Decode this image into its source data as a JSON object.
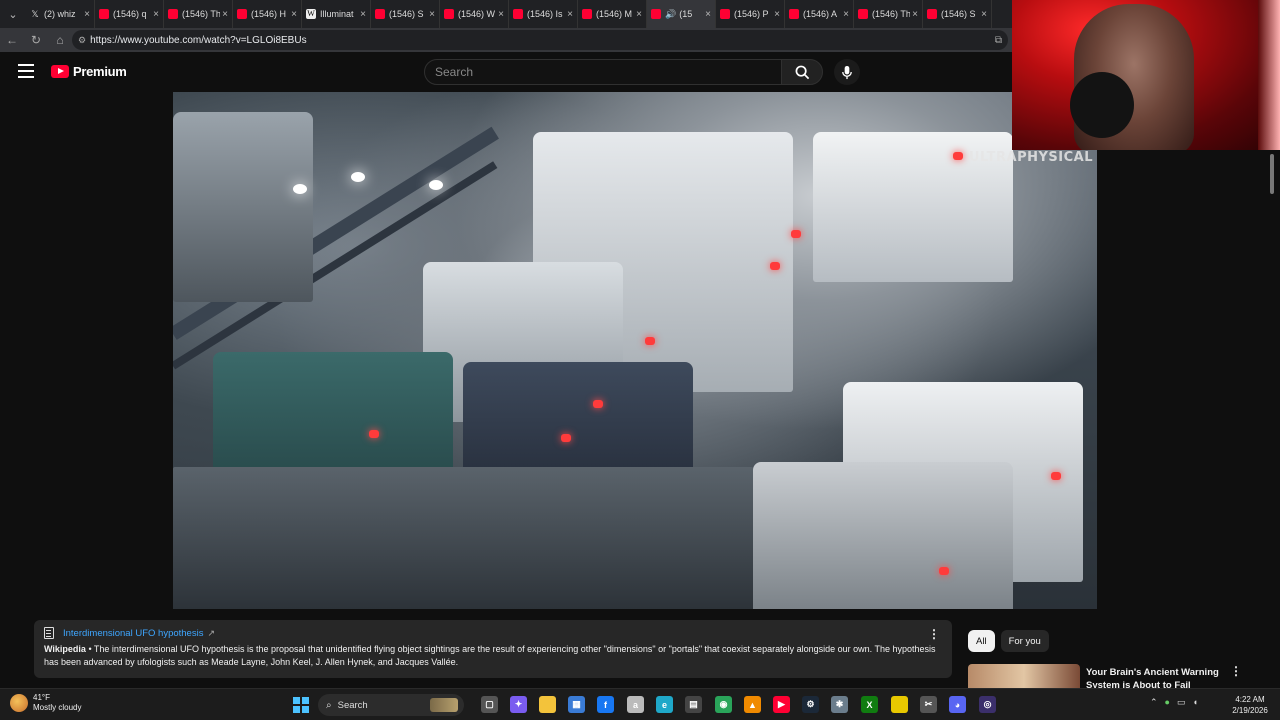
{
  "browser": {
    "tabs": [
      {
        "title": "(2) whiz",
        "fav": "x",
        "active": false
      },
      {
        "title": "(1546) q",
        "fav": "yt",
        "active": false
      },
      {
        "title": "(1546) Th",
        "fav": "yt",
        "active": false
      },
      {
        "title": "(1546) H",
        "fav": "yt",
        "active": false
      },
      {
        "title": "Illuminat",
        "fav": "w",
        "active": false
      },
      {
        "title": "(1546) S",
        "fav": "yt",
        "active": false
      },
      {
        "title": "(1546) W",
        "fav": "yt",
        "active": false
      },
      {
        "title": "(1546) Is",
        "fav": "yt",
        "active": false
      },
      {
        "title": "(1546) M",
        "fav": "yt",
        "active": false
      },
      {
        "title": "(15",
        "fav": "yt",
        "active": true
      },
      {
        "title": "(1546) P",
        "fav": "yt",
        "active": false
      },
      {
        "title": "(1546) A",
        "fav": "yt",
        "active": false
      },
      {
        "title": "(1546) Th",
        "fav": "yt",
        "active": false
      },
      {
        "title": "(1546) S",
        "fav": "yt",
        "active": false
      }
    ],
    "url": "https://www.youtube.com/watch?v=LGLOi8EBUs"
  },
  "youtube": {
    "logo_text": "Premium",
    "search_placeholder": "Search",
    "video_watermark": "ULTRAPHYSICAL"
  },
  "info_panel": {
    "link_title": "Interdimensional UFO hypothesis",
    "source": "Wikipedia",
    "text": " • The interdimensional UFO hypothesis is the proposal that unidentified flying object sightings are the result of experiencing other \"dimensions\" or \"portals\" that coexist separately alongside our own. The hypothesis has been advanced by ufologists such as Meade Layne, John Keel, J. Allen Hynek, and Jacques Vallée."
  },
  "chips": {
    "all": "All",
    "for_you": "For you"
  },
  "recommendation": {
    "title": "Your Brain's Ancient Warning System is About to Fail"
  },
  "taskbar": {
    "temp": "41°F",
    "weather": "Mostly cloudy",
    "search": "Search",
    "time": "4:22 AM",
    "date": "2/19/2026"
  },
  "colors": {
    "accent_blue": "#3ea6ff",
    "youtube_red": "#ff0033"
  }
}
